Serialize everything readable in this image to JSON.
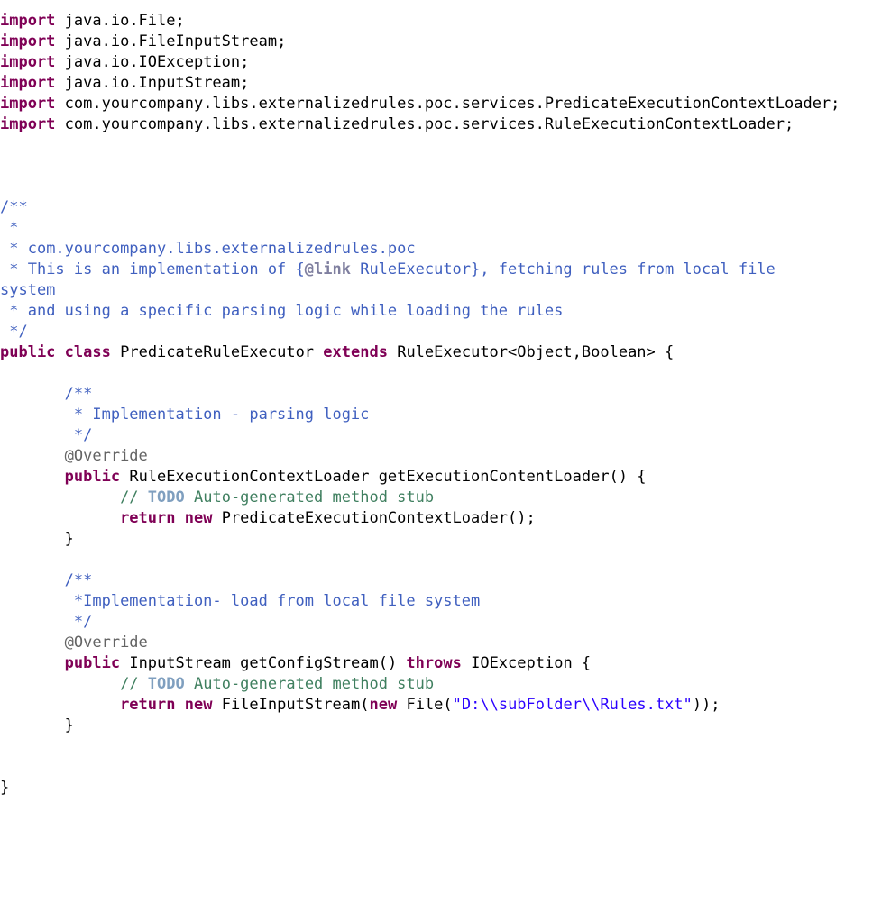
{
  "code": {
    "imports": [
      "java.io.File",
      "java.io.FileInputStream",
      "java.io.IOException",
      "java.io.InputStream",
      "com.yourcompany.libs.externalizedrules.poc.services.PredicateExecutionContextLoader",
      "com.yourcompany.libs.externalizedrules.poc.services.RuleExecutionContextLoader"
    ],
    "classdoc": {
      "lines": [
        "",
        "com.yourcompany.libs.externalizedrules.poc",
        "This is an implementation of {@link RuleExecutor}, fetching rules from local file system",
        "and using a specific parsing logic while loading the rules"
      ],
      "link_tag": "@link",
      "link_target": "RuleExecutor",
      "line_pre": "This is an implementation of {",
      "line_post": "}, fetching rules from local file"
    },
    "system_word": "system",
    "class_decl": {
      "kw_public": "public",
      "kw_class": "class",
      "name": "PredicateRuleExecutor",
      "kw_extends": "extends",
      "parent": "RuleExecutor<Object,Boolean>"
    },
    "method1": {
      "doc": "Implementation - parsing logic",
      "override": "@Override",
      "kw_public": "public",
      "ret": "RuleExecutionContextLoader",
      "name": "getExecutionContentLoader",
      "todo": "TODO",
      "todo_rest": "Auto-generated method stub",
      "kw_return": "return",
      "kw_new": "new",
      "expr": "PredicateExecutionContextLoader()"
    },
    "method2": {
      "doc": "Implementation- load from local file system",
      "override": "@Override",
      "kw_public": "public",
      "ret": "InputStream",
      "name": "getConfigStream",
      "kw_throws": "throws",
      "throws_type": "IOException",
      "todo": "TODO",
      "todo_rest": "Auto-generated method stub",
      "kw_return": "return",
      "kw_new1": "new",
      "cls1": "FileInputStream",
      "kw_new2": "new",
      "cls2": "File",
      "str": "\"D:\\\\subFolder\\\\Rules.txt\""
    },
    "kw_import": "import",
    "star": " *",
    "open_doc": "/**",
    "close_doc": " */",
    "slashes": "//"
  }
}
